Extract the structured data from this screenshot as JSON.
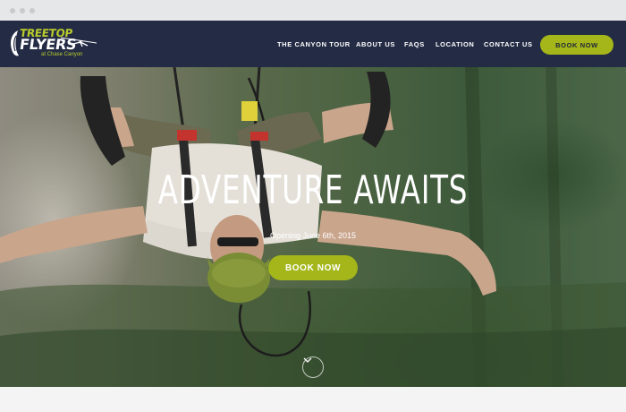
{
  "logo": {
    "line1": "TREETOP",
    "line2": "FLYERS",
    "line3": "at Chase Canyon",
    "icon": "zipline-rider-logo-icon"
  },
  "nav": {
    "items": [
      {
        "label": "THE CANYON TOUR"
      },
      {
        "label": "ABOUT US"
      },
      {
        "label": "FAQS"
      },
      {
        "label": "LOCATION"
      },
      {
        "label": "CONTACT US"
      }
    ],
    "book_label": "BOOK NOW"
  },
  "hero": {
    "title": "ADVENTURE AWAITS",
    "subtitle": "Opening June 6th, 2015",
    "book_label": "BOOK NOW",
    "scroll_icon": "chevron-down-icon"
  },
  "colors": {
    "header_bg": "#242c45",
    "accent": "#a4b61a",
    "logo_green": "#b9cb2b"
  }
}
